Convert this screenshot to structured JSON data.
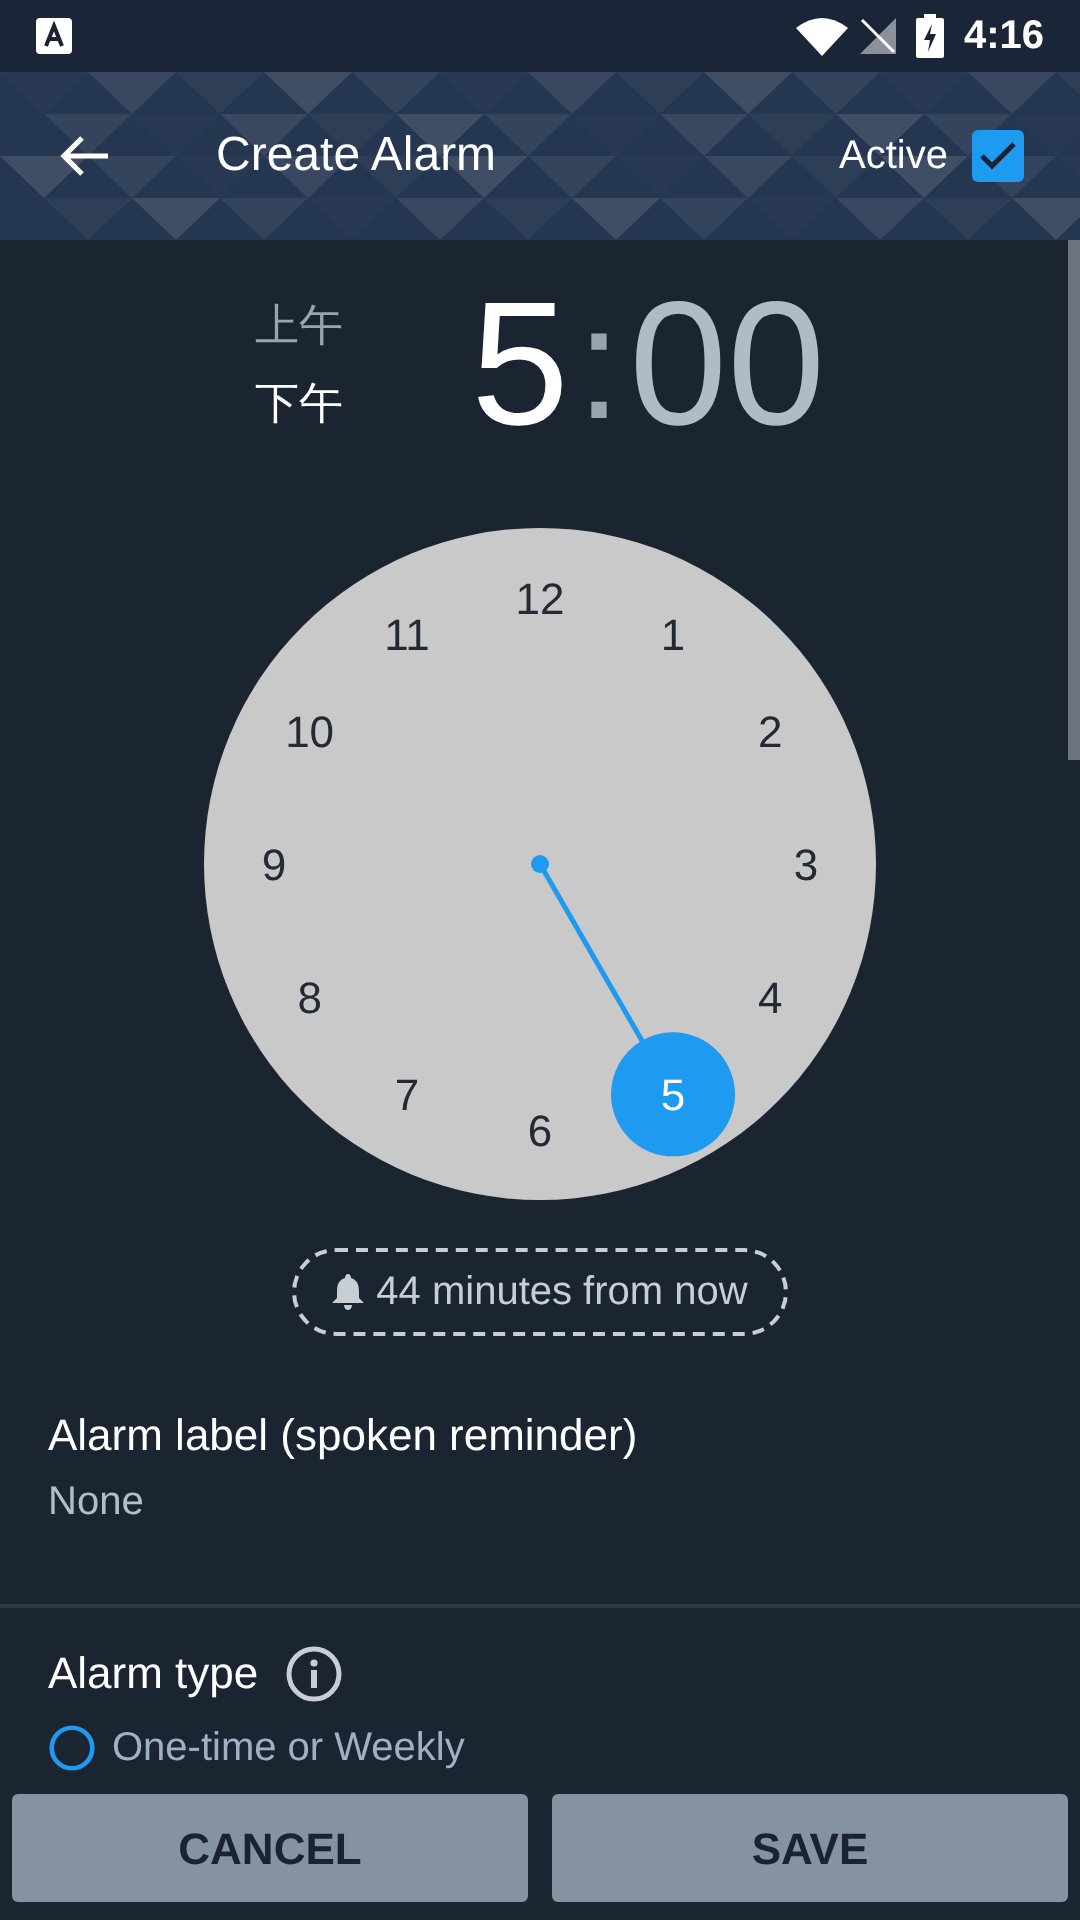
{
  "status_bar": {
    "time": "4:16"
  },
  "header": {
    "title": "Create Alarm",
    "active_label": "Active",
    "active": true
  },
  "time": {
    "periods": [
      {
        "label": "上午",
        "selected": false
      },
      {
        "label": "下午",
        "selected": true
      }
    ],
    "hour": "5",
    "separator": ":",
    "minutes": "00"
  },
  "clock": {
    "numbers": [
      {
        "label": "12",
        "selected": false
      },
      {
        "label": "1",
        "selected": false
      },
      {
        "label": "2",
        "selected": false
      },
      {
        "label": "3",
        "selected": false
      },
      {
        "label": "4",
        "selected": false
      },
      {
        "label": "5",
        "selected": true
      },
      {
        "label": "6",
        "selected": false
      },
      {
        "label": "7",
        "selected": false
      },
      {
        "label": "8",
        "selected": false
      },
      {
        "label": "9",
        "selected": false
      },
      {
        "label": "10",
        "selected": false
      },
      {
        "label": "11",
        "selected": false
      }
    ]
  },
  "countdown": "44 minutes from now",
  "settings": [
    {
      "title": "Alarm label (spoken reminder)",
      "value": "None"
    }
  ],
  "alarm_type": {
    "title": "Alarm type",
    "option": "One-time or Weekly"
  },
  "buttons": [
    "CANCEL",
    "SAVE"
  ]
}
